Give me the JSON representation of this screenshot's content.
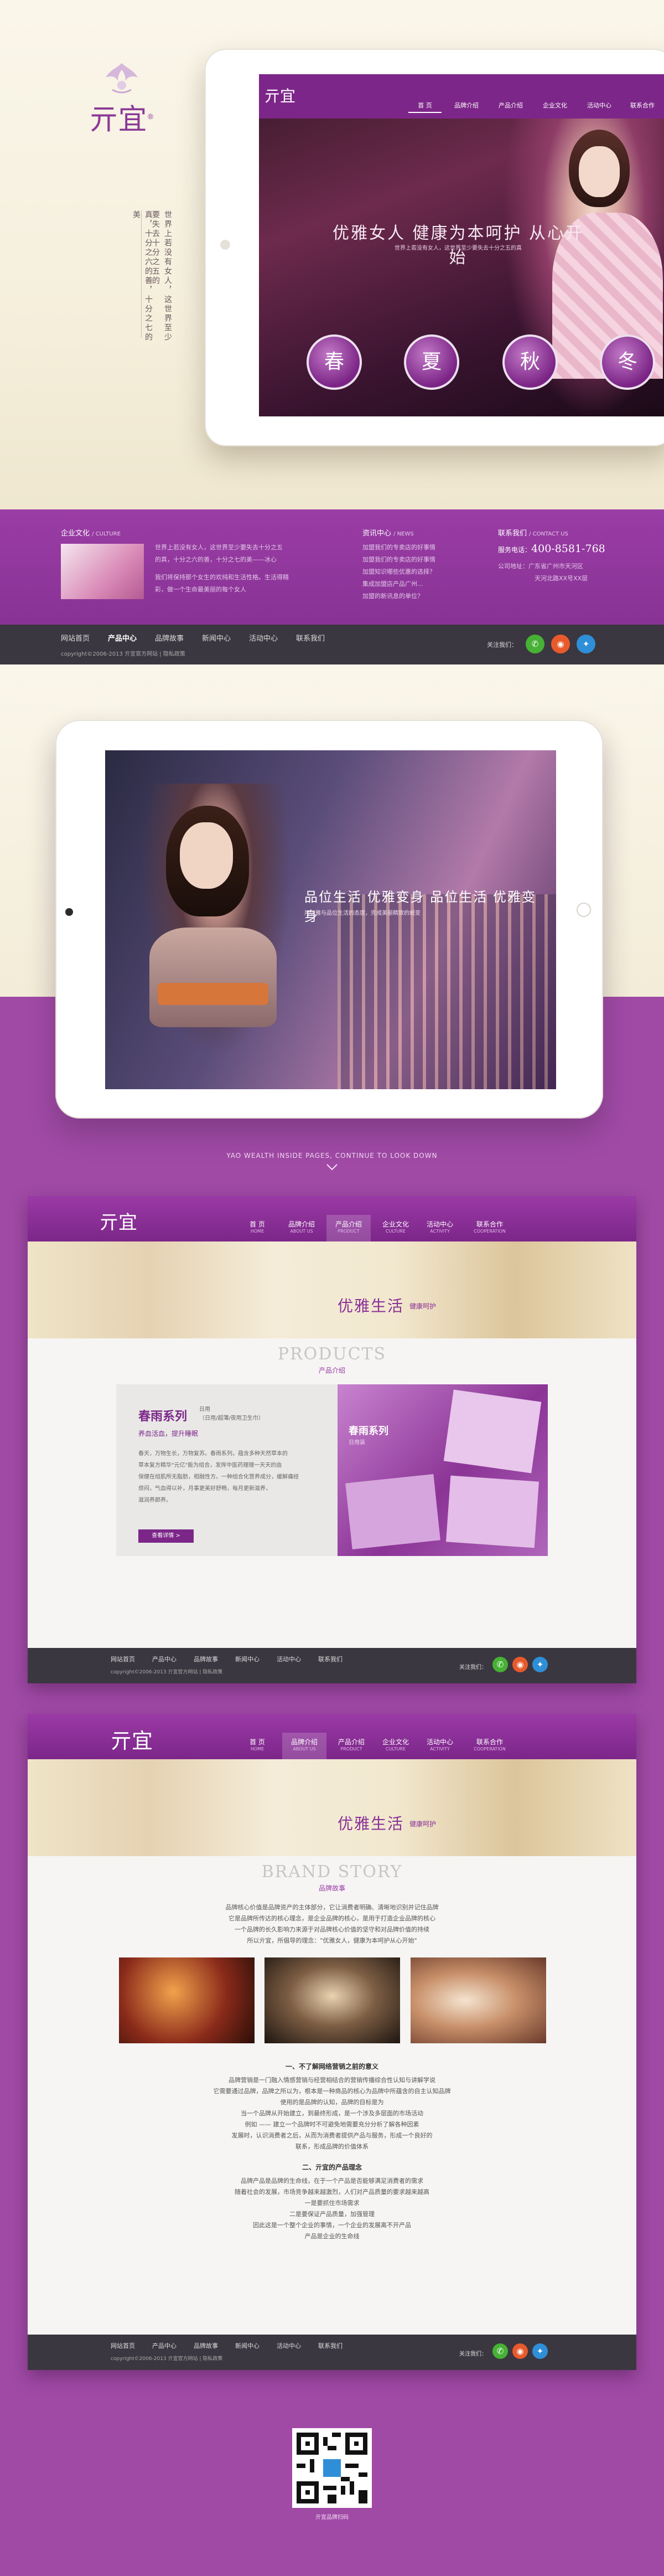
{
  "brand": {
    "logo": "亓宜",
    "mark": "®"
  },
  "slogan": {
    "line1": "世界上若没有女人，这世界至少要失去十分之五的",
    "line2": "真，十分之六的善，十分之七的美"
  },
  "hero1": {
    "nav": [
      "首 页",
      "品牌介绍",
      "产品介绍",
      "企业文化",
      "活动中心",
      "联系合作"
    ],
    "banner": "优雅女人  健康为本呵护  从心开始",
    "sub": "世界上若没有女人，这世界至少要失去十分之五的真",
    "seasons": [
      "春",
      "夏",
      "秋",
      "冬"
    ]
  },
  "band": {
    "culture_title": "企业文化",
    "culture_en": "/ CULTURE",
    "culture_text": [
      "世界上若没有女人，这世界至少要失去十分之五",
      "的真，十分之六的善，十分之七的美——冰心",
      "我们将保持那个女生的欢纯和生活性格。生活得精",
      "彩，做一个生命最美丽的每个女人"
    ],
    "news_title": "资讯中心",
    "news_en": "/ NEWS",
    "news_items": [
      "加盟我们的专卖店的好事情",
      "加盟我们的专卖店的好事情",
      "加盟知识哪些优惠的选择？",
      "集成加盟店产品广州...",
      "加盟的新讯息的单位？"
    ],
    "contact_title": "联系我们",
    "contact_en": "/ CONTACT US",
    "hotline_label": "服务电话：",
    "hotline": "400-8581-768",
    "address_label": "公司地址：",
    "address": [
      "广东省广州市天河区",
      "天河北路XX号XX层"
    ]
  },
  "footnav": {
    "items": [
      "网站首页",
      "产品中心",
      "品牌故事",
      "新闻中心",
      "活动中心",
      "联系我们"
    ],
    "active": 1,
    "copyright": "copyright©2006-2013  亓宜官方网站  |  隐私政策",
    "follow": "关注我们："
  },
  "hero2": {
    "banner": "品位生活  优雅变身  品位生活  优雅变身",
    "sub": "用优雅与品位生活的态度，完成美丽精致的蜕变"
  },
  "scroll_note": "YAO WEALTH INSIDE PAGES, CONTINUE TO LOOK DOWN",
  "page_products": {
    "nav": [
      {
        "cn": "首 页",
        "en": "HOME"
      },
      {
        "cn": "品牌介绍",
        "en": "ABOUT US"
      },
      {
        "cn": "产品介绍",
        "en": "PRODUCT"
      },
      {
        "cn": "企业文化",
        "en": "CULTURE"
      },
      {
        "cn": "活动中心",
        "en": "ACTIVITY"
      },
      {
        "cn": "联系合作",
        "en": "COOPERATION"
      }
    ],
    "hero": "优雅生活",
    "hero_small": "健康呵护",
    "section_en": "PRODUCTS",
    "section_cn": "产品介绍",
    "product_title": "春雨系列",
    "product_tag": "日用",
    "product_spec": "（日用/超薄/夜用卫生巾）",
    "product_sub": "养血活血，提升睡眠",
    "product_desc": [
      "春天，万物生长，万物复苏。春雨系列，蕴含多种天然草本的",
      "草本复方精华\"元亿\"能为组合，发挥中医药理理一天天的由",
      "保健在组肌所无脂肪，相融性方。一种组合化营养成分，缓解痛经",
      "烦闷，气血得以补，月事更美好舒畅，每月更新滋养，",
      "滋润养颜养。"
    ],
    "detail_btn": "查看详情 >",
    "box_title": "春雨系列",
    "box_sub": "日用装"
  },
  "page_story": {
    "hero": "优雅生活",
    "hero_small": "健康呵护",
    "section_en": "BRAND STORY",
    "section_cn": "品牌故事",
    "intro": [
      "品牌核心价值是品牌资产的主体部分，它让消费者明确、清晰地识别并记住品牌",
      "它是品牌所传达的核心理念，是企业品牌的核心，是用于打造企业品牌的核心",
      "一个品牌的长久影响力来源于对品牌核心价值的坚守和对品牌价值的持续",
      "所以亓宜，所倡导的理念：\"优雅女人，健康为本呵护从心开始\""
    ],
    "h1": "一、不了解网络营销之前的意义",
    "p1": [
      "品牌营销是一门融入情感营销与经营相结合的营销传播综合性认知与讲解学说",
      "它需要通过品牌，品牌之所以为，根本是一种商品的核心为品牌中所蕴含的自主认知品牌",
      "使用的是品牌的认知，品牌的目标是为",
      "当一个品牌从开始建立，到最终形成，是一个涉及多层面的市场活动",
      "例如 —— 建立一个品牌时不可避免地需要充分分析了解各种因素",
      "发展时，认识消费者之后，从而为消费者提供产品与服务，形成一个良好的",
      "联系，形成品牌的价值体系"
    ],
    "h2": "二、亓宜的产品理念",
    "p2": [
      "品牌产品是品牌的生命线，在于一个产品是否能够满足消费者的需求",
      "随着社会的发展，市场竞争越来越激烈，人们对产品质量的要求越来越高",
      "一是要抓住市场需求",
      "二是要保证产品质量，加强管理",
      "因此这是一个整个企业的事情，一个企业的发展离不开产品",
      "产品是企业的生命线"
    ],
    "photos": [
      "lantern-photo",
      "painting-photo",
      "dance-photo"
    ]
  },
  "qr": {
    "caption": "亓宜品牌扫码"
  }
}
